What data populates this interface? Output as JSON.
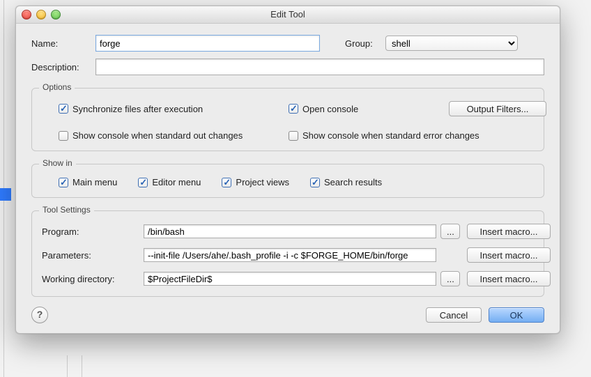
{
  "window": {
    "title": "Edit Tool"
  },
  "form": {
    "name_label": "Name:",
    "name_value": "forge",
    "group_label": "Group:",
    "group_value": "shell",
    "description_label": "Description:",
    "description_value": ""
  },
  "options": {
    "legend": "Options",
    "sync_label": "Synchronize files after execution",
    "sync_checked": true,
    "open_console_label": "Open console",
    "open_console_checked": true,
    "output_filters_label": "Output Filters...",
    "stdout_label": "Show console when standard out changes",
    "stdout_checked": false,
    "stderr_label": "Show console when standard error changes",
    "stderr_checked": false
  },
  "show_in": {
    "legend": "Show in",
    "main_menu": {
      "label": "Main menu",
      "checked": true
    },
    "editor_menu": {
      "label": "Editor menu",
      "checked": true
    },
    "project_views": {
      "label": "Project views",
      "checked": true
    },
    "search_results": {
      "label": "Search results",
      "checked": true
    }
  },
  "tool_settings": {
    "legend": "Tool Settings",
    "program_label": "Program:",
    "program_value": "/bin/bash",
    "parameters_label": "Parameters:",
    "parameters_value": "--init-file /Users/ahe/.bash_profile -i -c $FORGE_HOME/bin/forge",
    "workdir_label": "Working directory:",
    "workdir_value": "$ProjectFileDir$",
    "browse_label": "...",
    "insert_macro_label": "Insert macro..."
  },
  "footer": {
    "help_label": "?",
    "cancel_label": "Cancel",
    "ok_label": "OK"
  }
}
